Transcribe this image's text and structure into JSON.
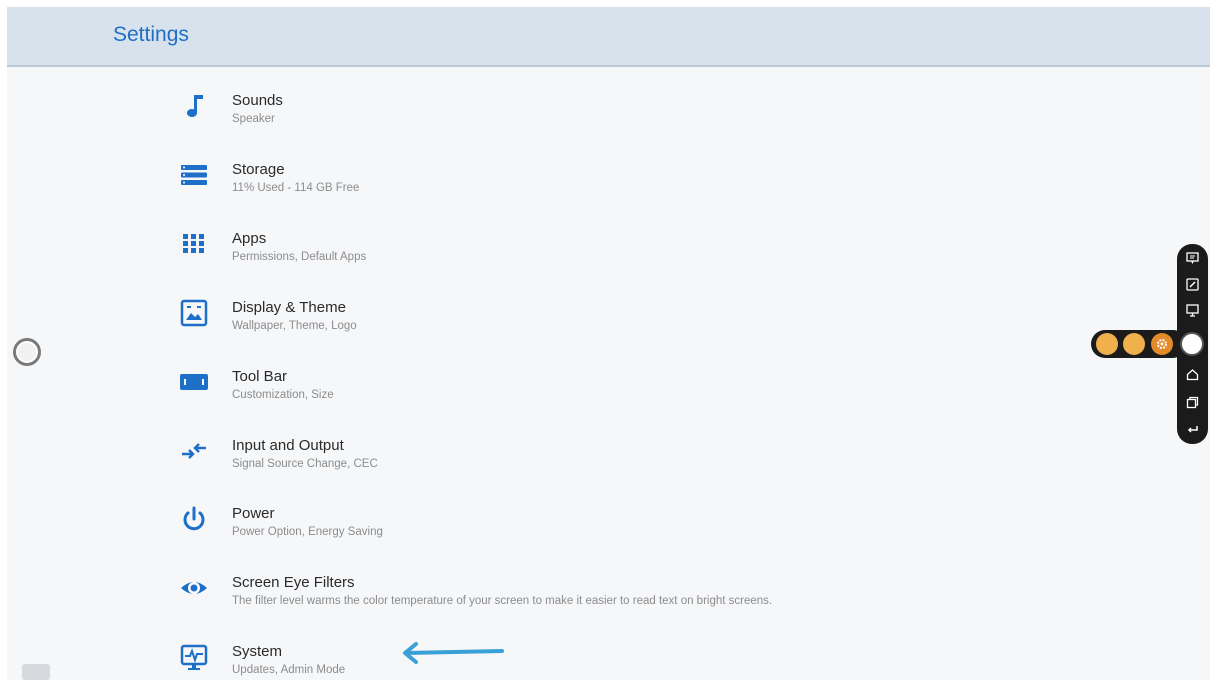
{
  "header": {
    "title": "Settings"
  },
  "items": [
    {
      "label": "Sounds",
      "sub": "Speaker",
      "icon": "music-note-icon"
    },
    {
      "label": "Storage",
      "sub": "11% Used - 114 GB Free",
      "icon": "storage-icon"
    },
    {
      "label": "Apps",
      "sub": "Permissions, Default Apps",
      "icon": "apps-grid-icon"
    },
    {
      "label": "Display & Theme",
      "sub": "Wallpaper, Theme, Logo",
      "icon": "display-theme-icon"
    },
    {
      "label": "Tool Bar",
      "sub": "Customization, Size",
      "icon": "toolbar-icon"
    },
    {
      "label": "Input and Output",
      "sub": "Signal Source Change, CEC",
      "icon": "input-output-icon"
    },
    {
      "label": "Power",
      "sub": "Power Option, Energy Saving",
      "icon": "power-icon"
    },
    {
      "label": "Screen Eye Filters",
      "sub": "The filter level warms the color temperature of your screen to make it easier to read text on bright screens.",
      "icon": "eye-icon"
    },
    {
      "label": "System",
      "sub": "Updates, Admin Mode",
      "icon": "system-monitor-icon"
    }
  ],
  "colors": {
    "accent": "#1d6fc7",
    "header_bg": "#d8e2ec",
    "arrow": "#3aa0d8",
    "toolbar_bg": "#1b1b1b",
    "toolbar_dot": "#f0b04c"
  }
}
